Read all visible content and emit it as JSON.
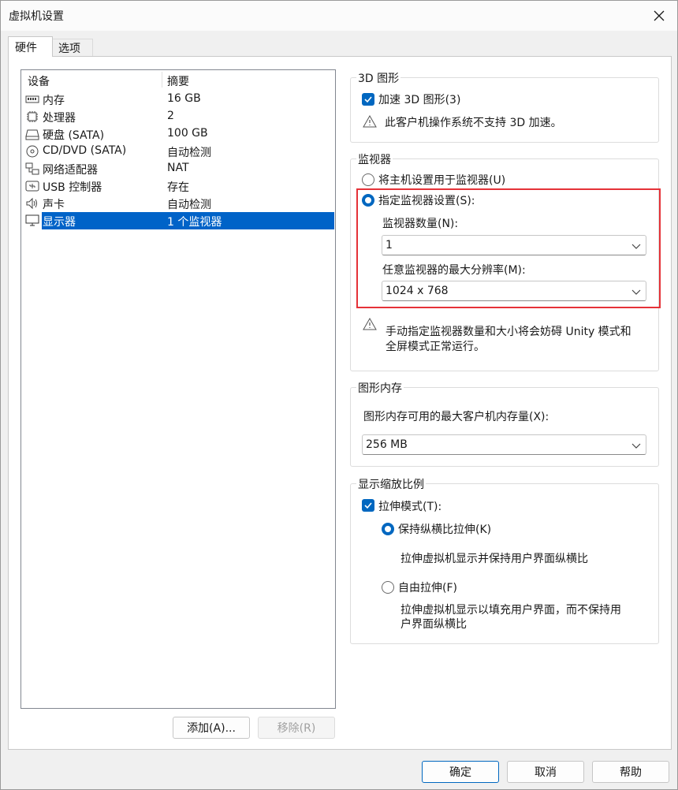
{
  "window": {
    "title": "虚拟机设置"
  },
  "tabs": [
    {
      "label": "硬件"
    },
    {
      "label": "选项"
    }
  ],
  "device_list": {
    "headers": {
      "device": "设备",
      "summary": "摘要"
    },
    "rows": [
      {
        "name": "内存",
        "summary": "16 GB",
        "icon": "memory-icon"
      },
      {
        "name": "处理器",
        "summary": "2",
        "icon": "cpu-icon"
      },
      {
        "name": "硬盘 (SATA)",
        "summary": "100 GB",
        "icon": "hard-disk-icon"
      },
      {
        "name": "CD/DVD (SATA)",
        "summary": "自动检测",
        "icon": "cd-dvd-icon"
      },
      {
        "name": "网络适配器",
        "summary": "NAT",
        "icon": "network-adapter-icon"
      },
      {
        "name": "USB 控制器",
        "summary": "存在",
        "icon": "usb-icon"
      },
      {
        "name": "声卡",
        "summary": "自动检测",
        "icon": "speaker-icon"
      },
      {
        "name": "显示器",
        "summary": "1 个监视器",
        "icon": "monitor-icon",
        "selected": true
      }
    ]
  },
  "left_buttons": {
    "add": "添加(A)...",
    "remove": "移除(R)"
  },
  "graphics_3d": {
    "group_label": "3D 图形",
    "accelerate_label": "加速 3D 图形(3)",
    "accelerate_checked": true,
    "warning": "此客户机操作系统不支持 3D 加速。"
  },
  "monitors": {
    "group_label": "监视器",
    "use_host_label": "将主机设置用于监视器(U)",
    "specify_label": "指定监视器设置(S):",
    "selected_option": "specify",
    "count_label": "监视器数量(N):",
    "count_value": "1",
    "max_res_label": "任意监视器的最大分辨率(M):",
    "max_res_value": "1024 x 768",
    "warning_line1": "手动指定监视器数量和大小将会妨碍 Unity 模式和",
    "warning_line2": "全屏模式正常运行。"
  },
  "graphics_memory": {
    "group_label": "图形内存",
    "max_label": "图形内存可用的最大客户机内存量(X):",
    "value": "256 MB"
  },
  "display_scaling": {
    "group_label": "显示缩放比例",
    "stretch_label": "拉伸模式(T):",
    "stretch_checked": true,
    "keep_aspect_label": "保持纵横比拉伸(K)",
    "keep_aspect_desc": "拉伸虚拟机显示并保持用户界面纵横比",
    "free_stretch_label": "自由拉伸(F)",
    "free_stretch_desc_line1": "拉伸虚拟机显示以填充用户界面，而不保持用",
    "free_stretch_desc_line2": "户界面纵横比",
    "selected_option": "keep_aspect"
  },
  "footer": {
    "ok": "确定",
    "cancel": "取消",
    "help": "帮助"
  },
  "colors": {
    "accent": "#0067c0",
    "selection": "#0063c8",
    "highlight_box": "#e53238"
  }
}
